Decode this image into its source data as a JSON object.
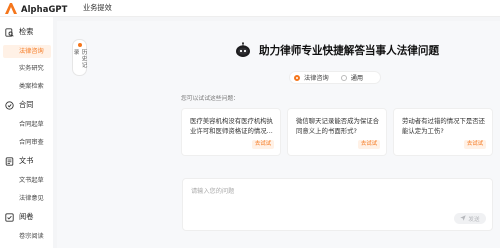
{
  "app": {
    "name": "AlphaGPT"
  },
  "topnav": {
    "label": "业务提效"
  },
  "colors": {
    "accent": "#f5761c"
  },
  "sidebar": {
    "groups": [
      {
        "title": "检索",
        "icon": "search-doc-icon",
        "items": [
          "法律咨询",
          "实务研究",
          "类案检索"
        ]
      },
      {
        "title": "合同",
        "icon": "contract-icon",
        "items": [
          "合同起草",
          "合同审查"
        ]
      },
      {
        "title": "文书",
        "icon": "document-icon",
        "items": [
          "文书起草",
          "法律意见"
        ]
      },
      {
        "title": "阅卷",
        "icon": "case-file-icon",
        "items": [
          "卷宗阅读"
        ]
      }
    ],
    "active_item": "法律咨询"
  },
  "history": {
    "label": "历史记录"
  },
  "hero": {
    "title": "助力律师专业快捷解答当事人法律问题"
  },
  "modes": [
    {
      "label": "法律咨询",
      "selected": true
    },
    {
      "label": "通用",
      "selected": false
    }
  ],
  "try_section": {
    "title": "您可以试试这些问题：",
    "cards": [
      {
        "text": "医疗美容机构没有医疗机构执业许可和医师资格证的情况...",
        "button": "去试试"
      },
      {
        "text": "微信聊天记录能否成为保证合同意义上的书面形式?",
        "button": "去试试"
      },
      {
        "text": "劳动者有过错的情况下是否还能认定为工伤?",
        "button": "去试试"
      }
    ]
  },
  "input": {
    "placeholder": "请输入您的问题",
    "value": ""
  },
  "send": {
    "label": "发送",
    "icon": "send-icon"
  }
}
